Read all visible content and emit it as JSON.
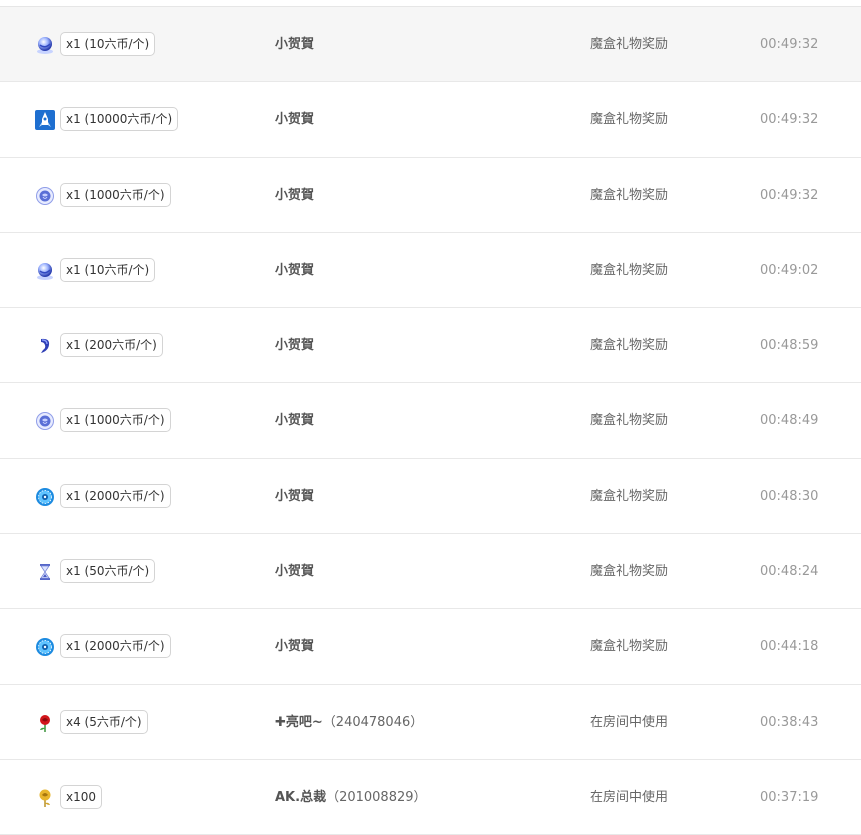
{
  "records": [
    {
      "icon": "crystal-orb-gift-icon",
      "count": "x1 (10六币/个)",
      "user": "小贺賀",
      "uid": "",
      "source": "魔盒礼物奖励",
      "time": "00:49:32",
      "highlight": true
    },
    {
      "icon": "rocket-gift-icon",
      "count": "x1 (10000六币/个)",
      "user": "小贺賀",
      "uid": "",
      "source": "魔盒礼物奖励",
      "time": "00:49:32",
      "highlight": false
    },
    {
      "icon": "blue-rose-ball-gift-icon",
      "count": "x1 (1000六币/个)",
      "user": "小贺賀",
      "uid": "",
      "source": "魔盒礼物奖励",
      "time": "00:49:32",
      "highlight": false
    },
    {
      "icon": "crystal-orb-gift-icon",
      "count": "x1 (10六币/个)",
      "user": "小贺賀",
      "uid": "",
      "source": "魔盒礼物奖励",
      "time": "00:49:02",
      "highlight": false
    },
    {
      "icon": "blue-horn-gift-icon",
      "count": "x1 (200六币/个)",
      "user": "小贺賀",
      "uid": "",
      "source": "魔盒礼物奖励",
      "time": "00:48:59",
      "highlight": false
    },
    {
      "icon": "blue-rose-ball-gift-icon",
      "count": "x1 (1000六币/个)",
      "user": "小贺賀",
      "uid": "",
      "source": "魔盒礼物奖励",
      "time": "00:48:49",
      "highlight": false
    },
    {
      "icon": "blue-wheel-gift-icon",
      "count": "x1 (2000六币/个)",
      "user": "小贺賀",
      "uid": "",
      "source": "魔盒礼物奖励",
      "time": "00:48:30",
      "highlight": false
    },
    {
      "icon": "hourglass-gift-icon",
      "count": "x1 (50六币/个)",
      "user": "小贺賀",
      "uid": "",
      "source": "魔盒礼物奖励",
      "time": "00:48:24",
      "highlight": false
    },
    {
      "icon": "blue-wheel-gift-icon",
      "count": "x1 (2000六币/个)",
      "user": "小贺賀",
      "uid": "",
      "source": "魔盒礼物奖励",
      "time": "00:44:18",
      "highlight": false
    },
    {
      "icon": "red-rose-gift-icon",
      "count": "x4 (5六币/个)",
      "user": "✚亮吧~",
      "uid": "（240478046）",
      "source": "在房间中使用",
      "time": "00:38:43",
      "highlight": false
    },
    {
      "icon": "gold-rose-gift-icon",
      "count": "x100",
      "user": "AK.总裁",
      "uid": "（201008829）",
      "source": "在房间中使用",
      "time": "00:37:19",
      "highlight": false
    }
  ]
}
